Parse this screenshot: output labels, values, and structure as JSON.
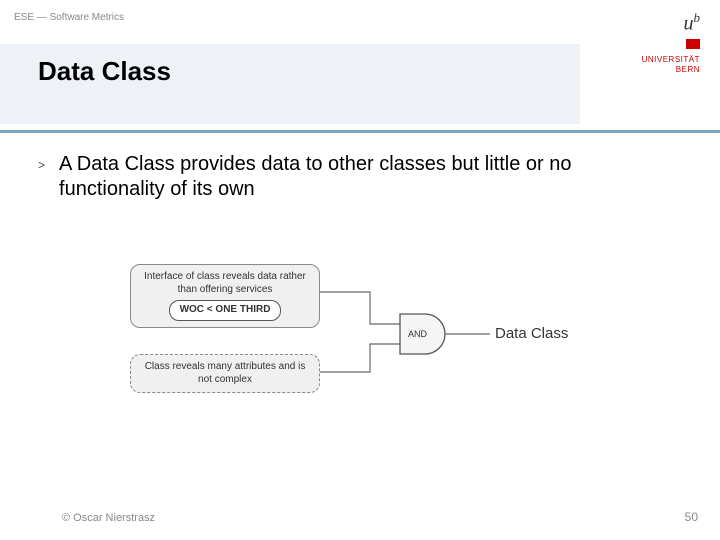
{
  "header": {
    "course": "ESE — Software Metrics"
  },
  "title": "Data Class",
  "logo": {
    "letters": "u",
    "sup": "b",
    "uni_line1": "UNIVERSITÄT",
    "uni_line2": "BERN"
  },
  "body": {
    "bullet_marker": ">",
    "bullet_text": "A Data Class provides data to other classes but little or no functionality of its own"
  },
  "diagram": {
    "box1_text": "Interface of class reveals data rather than offering services",
    "box1_metric": "WOC < ONE THIRD",
    "box2_text": "Class reveals many attributes and is not complex",
    "gate": "AND",
    "result": "Data Class"
  },
  "footer": {
    "author": "© Oscar Nierstrasz",
    "page": "50"
  }
}
